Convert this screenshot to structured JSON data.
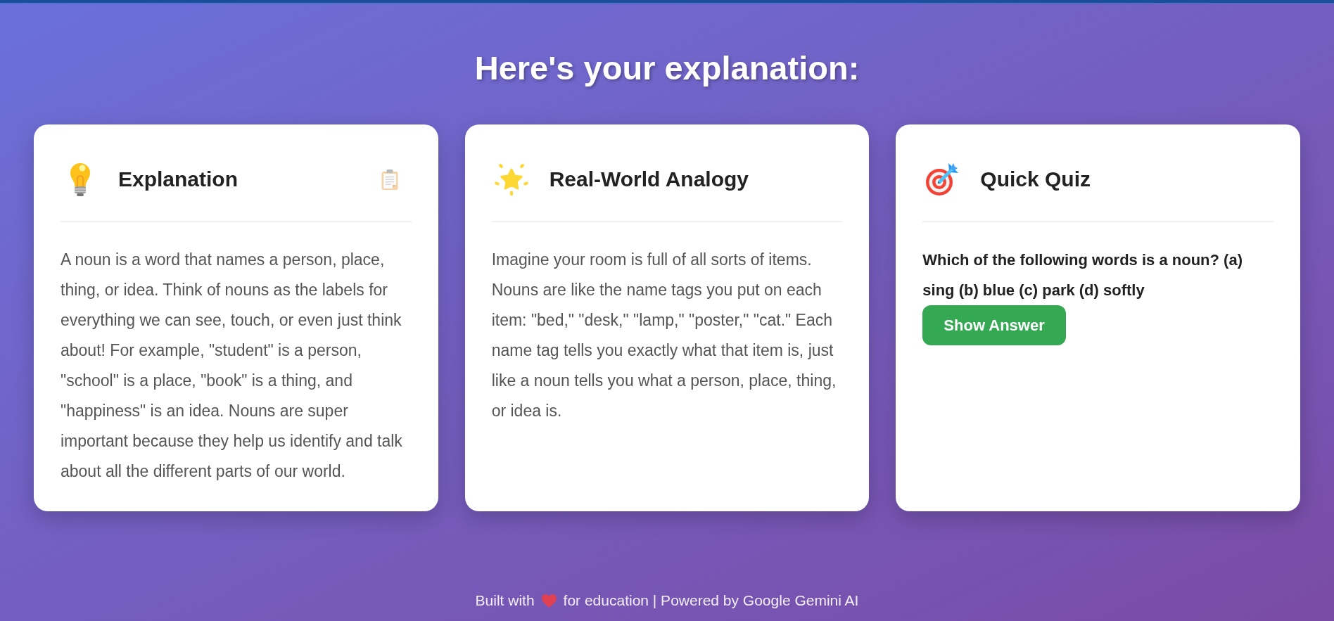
{
  "heading": "Here's your explanation:",
  "cards": [
    {
      "kind": "explanation",
      "title": "Explanation",
      "copy_button": true,
      "body": "A noun is a word that names a person, place, thing, or idea. Think of nouns as the labels for everything we can see, touch, or even just think about! For example, \"student\" is a person, \"school\" is a place, \"book\" is a thing, and \"happiness\" is an idea. Nouns are super important because they help us identify and talk about all the different parts of our world."
    },
    {
      "kind": "analogy",
      "title": "Real-World Analogy",
      "copy_button": false,
      "body": "Imagine your room is full of all sorts of items. Nouns are like the name tags you put on each item: \"bed,\" \"desk,\" \"lamp,\" \"poster,\" \"cat.\" Each name tag tells you exactly what that item is, just like a noun tells you what a person, place, thing, or idea is."
    },
    {
      "kind": "quiz",
      "title": "Quick Quiz",
      "copy_button": false,
      "question": "Which of the following words is a noun? (a) sing (b) blue (c) park (d) softly",
      "button": "Show Answer"
    }
  ],
  "footer": {
    "before": "Built with",
    "after": "for education | Powered by Google Gemini AI"
  }
}
